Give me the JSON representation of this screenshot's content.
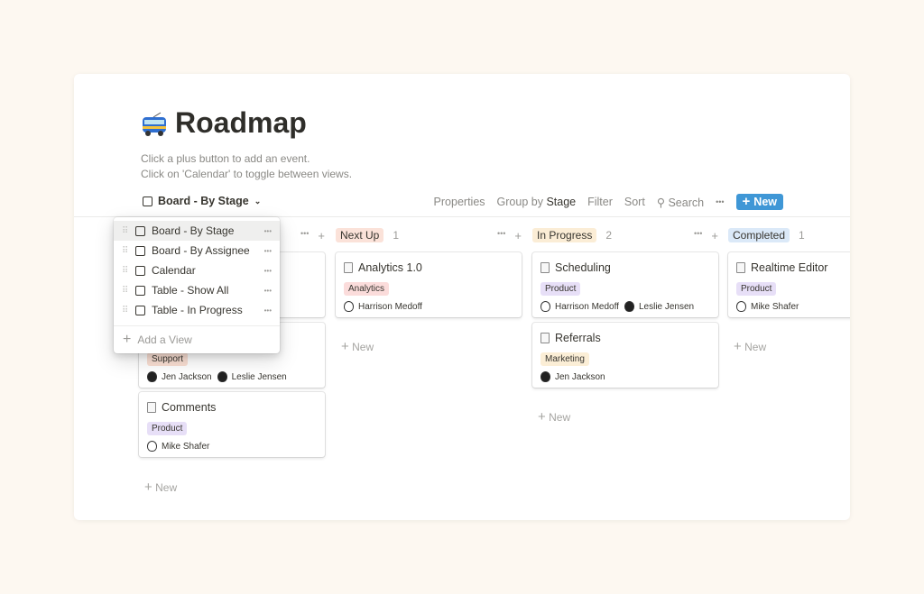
{
  "page": {
    "title": "Roadmap",
    "emoji": "trolleybus",
    "description": [
      "Click a plus button to add an event.",
      "Click on 'Calendar' to toggle between views."
    ]
  },
  "view_selector": {
    "label": "Board - By Stage",
    "icon": "board-icon"
  },
  "toolbar": {
    "properties": "Properties",
    "group_by": "Group by",
    "group_value": "Stage",
    "filter": "Filter",
    "sort": "Sort",
    "search": "Search",
    "more": "•••",
    "new": "New",
    "accent": "#3f97d6"
  },
  "columns": [
    {
      "name": "",
      "count": "",
      "color": "",
      "cards": [
        {
          "title": "",
          "tag": "",
          "tag_color": "",
          "people": []
        },
        {
          "title": "",
          "tag": "Support",
          "tag_color": "#fadfd3",
          "people": [
            {
              "name": "Jen Jackson",
              "dark": true
            },
            {
              "name": "Leslie Jensen",
              "dark": true
            }
          ]
        },
        {
          "title": "Comments",
          "tag": "Product",
          "tag_color": "#e7dff7",
          "people": [
            {
              "name": "Mike Shafer"
            }
          ]
        }
      ]
    },
    {
      "name": "Next Up",
      "count": "1",
      "color": "#fbe2d9",
      "cards": [
        {
          "title": "Analytics 1.0",
          "tag": "Analytics",
          "tag_color": "#fbdcdb",
          "people": [
            {
              "name": "Harrison Medoff"
            }
          ]
        }
      ]
    },
    {
      "name": "In Progress",
      "count": "2",
      "color": "#fbedd6",
      "cards": [
        {
          "title": "Scheduling",
          "tag": "Product",
          "tag_color": "#e7dff7",
          "people": [
            {
              "name": "Harrison Medoff"
            },
            {
              "name": "Leslie Jensen",
              "dark": true
            }
          ]
        },
        {
          "title": "Referrals",
          "tag": "Marketing",
          "tag_color": "#fbeed6",
          "people": [
            {
              "name": "Jen Jackson",
              "dark": true
            }
          ]
        }
      ]
    },
    {
      "name": "Completed",
      "count": "1",
      "color": "#dbe9f8",
      "cards": [
        {
          "title": "Realtime Editor",
          "tag": "Product",
          "tag_color": "#e7dff7",
          "people": [
            {
              "name": "Mike Shafer"
            }
          ]
        }
      ]
    }
  ],
  "new_label": "New",
  "views_menu": {
    "items": [
      {
        "label": "Board - By Stage",
        "icon": "board-icon",
        "active": true
      },
      {
        "label": "Board - By Assignee",
        "icon": "board-icon"
      },
      {
        "label": "Calendar",
        "icon": "calendar-icon"
      },
      {
        "label": "Table - Show All",
        "icon": "table-icon"
      },
      {
        "label": "Table - In Progress",
        "icon": "table-icon"
      }
    ],
    "add": "Add a View",
    "more": "•••"
  }
}
